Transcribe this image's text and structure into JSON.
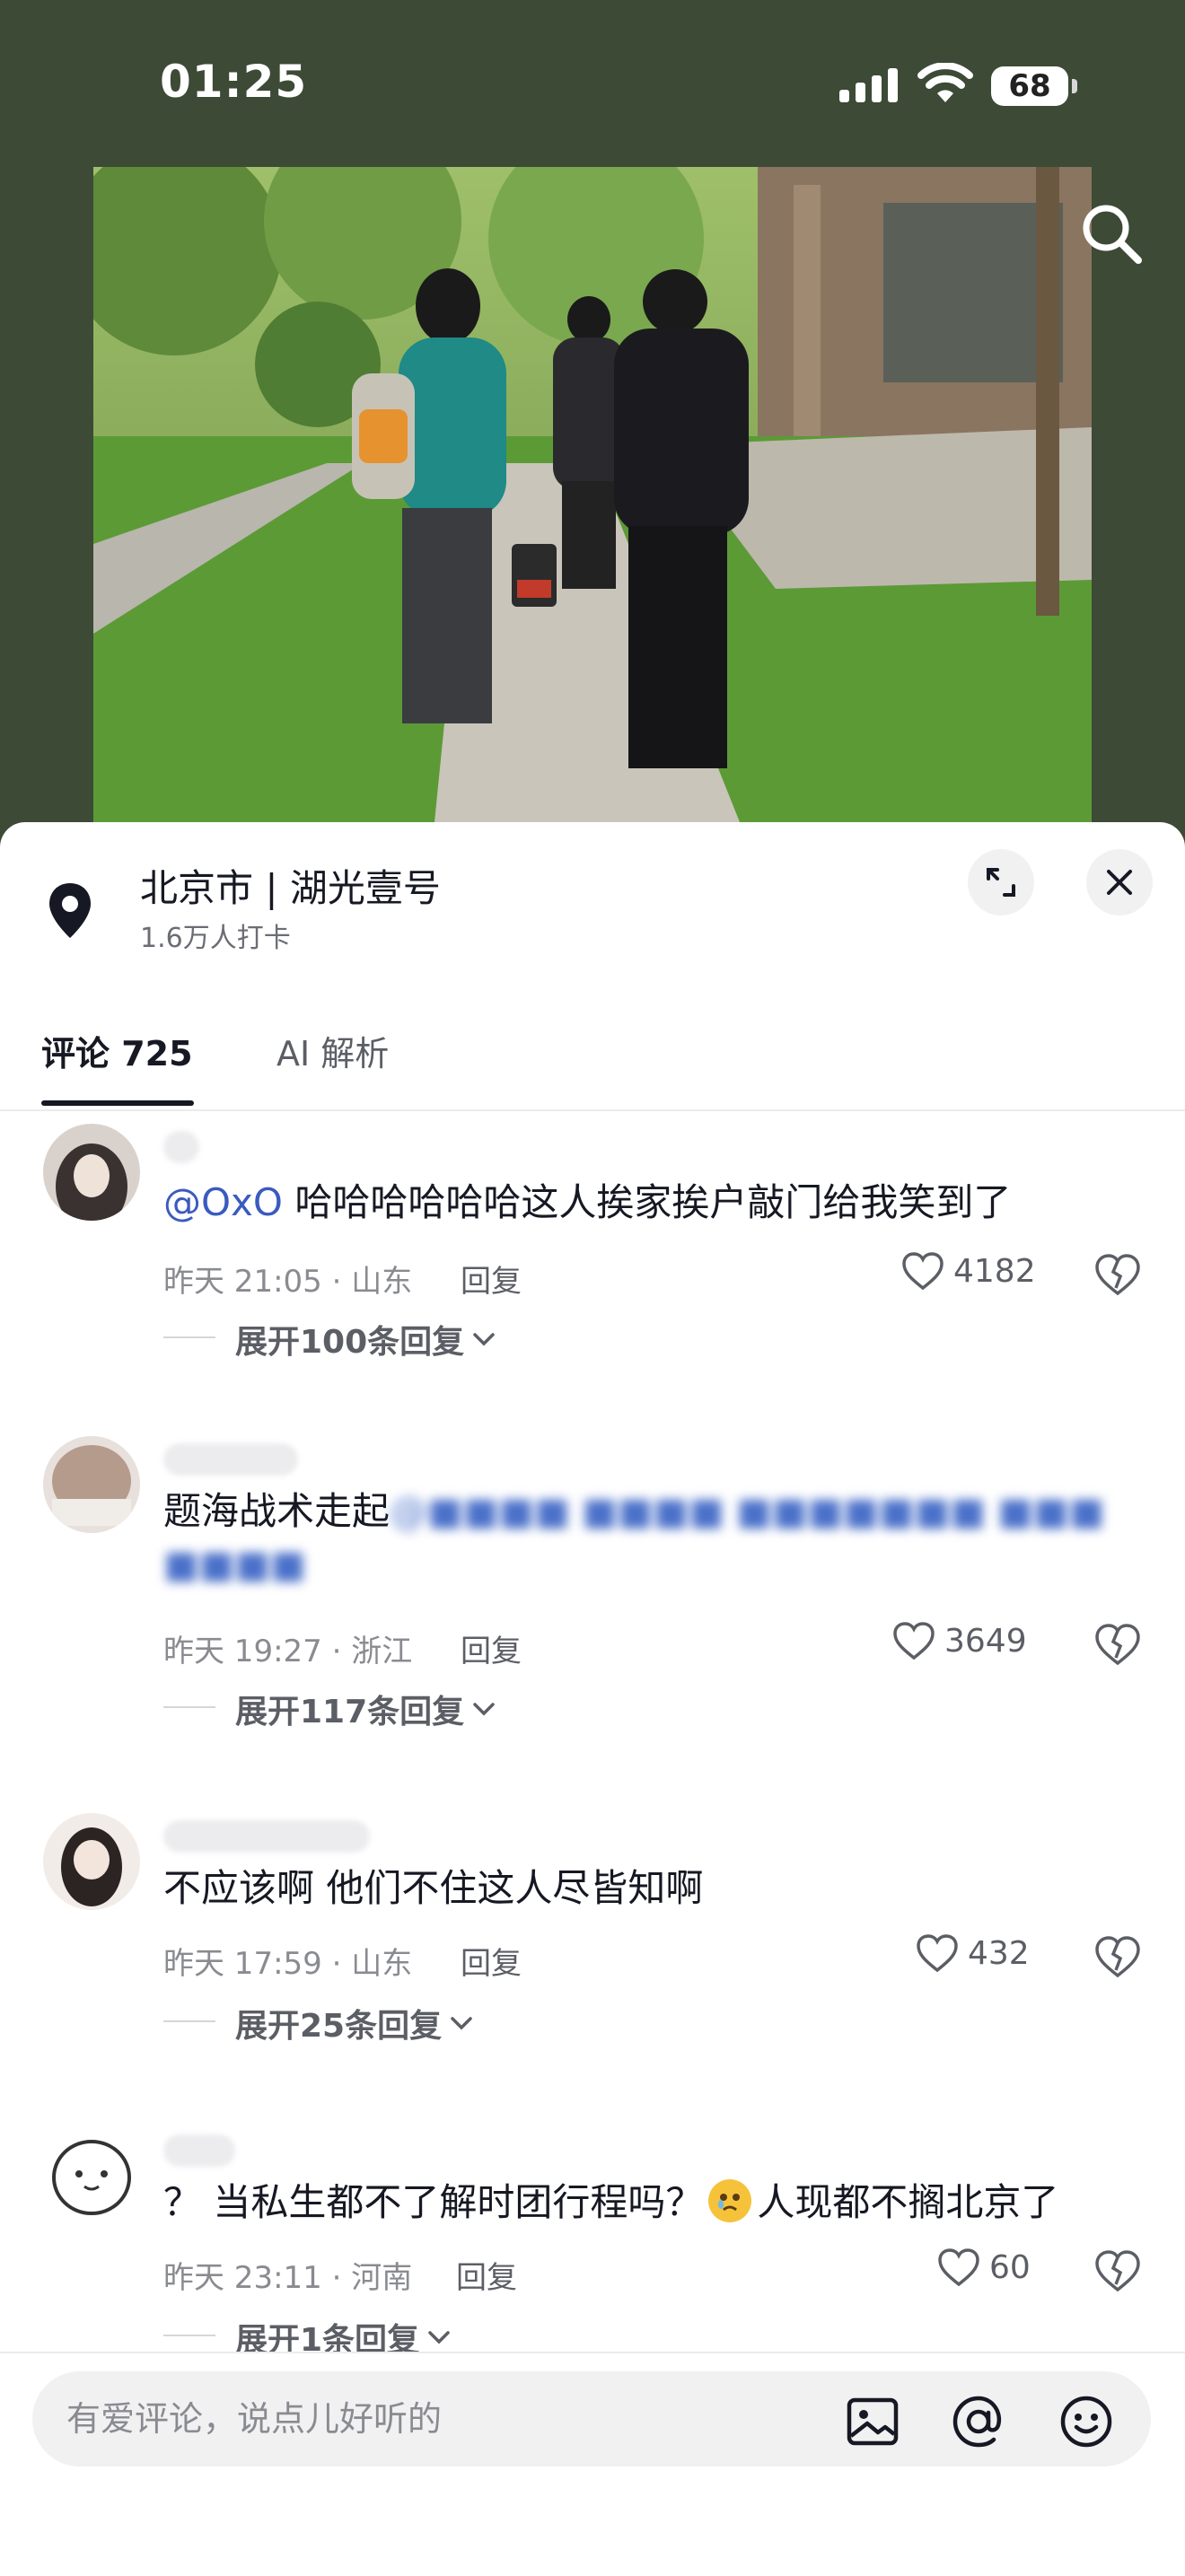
{
  "status_bar": {
    "time": "01:25",
    "battery": "68"
  },
  "location": {
    "title": "北京市 | 湖光壹号",
    "checkins": "1.6万人打卡"
  },
  "tabs": [
    {
      "label": "评论 725",
      "active": true
    },
    {
      "label": "AI 解析",
      "active": false
    }
  ],
  "comments": [
    {
      "mention": "@OxO",
      "text": " 哈哈哈哈哈哈这人挨家挨户敲门给我笑到了",
      "meta": "昨天 21:05 · 山东",
      "reply_label": "回复",
      "likes": "4182",
      "expand_label": "展开100条回复"
    },
    {
      "text": "题海战术走起",
      "meta": "昨天 19:27 · 浙江",
      "reply_label": "回复",
      "likes": "3649",
      "expand_label": "展开117条回复"
    },
    {
      "text": "不应该啊 他们不住这人尽皆知啊",
      "meta": "昨天 17:59 · 山东",
      "reply_label": "回复",
      "likes": "432",
      "expand_label": "展开25条回复"
    },
    {
      "text_before": "？ 当私生都不了解时团行程吗？",
      "text_after": "人现都不搁北京了",
      "meta": "昨天 23:11 · 河南",
      "reply_label": "回复",
      "likes": "60",
      "expand_label": "展开1条回复"
    }
  ],
  "input": {
    "placeholder": "有爱评论，说点儿好听的"
  },
  "colors": {
    "mention": "#3a5bbf",
    "sheet_bg": "#ffffff",
    "photo_bg": "#3c4a36"
  }
}
